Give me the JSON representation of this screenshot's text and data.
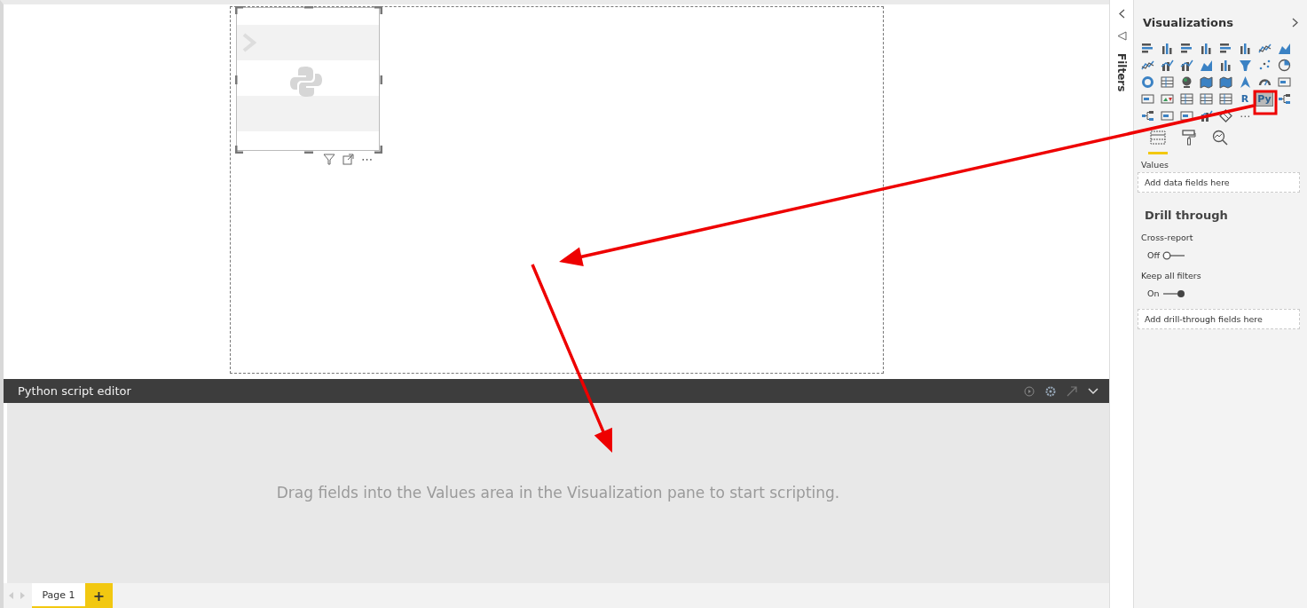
{
  "report_canvas": {
    "visual_header": {
      "more": "⋯"
    }
  },
  "script_editor": {
    "title": "Python script editor",
    "message": "Drag fields into the Values area in the Visualization pane to start scripting."
  },
  "page_tabs": [
    {
      "label": "Page 1",
      "selected": true
    }
  ],
  "add_page": "+",
  "filters_pane": {
    "label": "Filters",
    "expanded": false
  },
  "visualizations": {
    "title": "Visualizations",
    "script_visuals": [
      {
        "label": "R",
        "selected": false
      },
      {
        "label": "Py",
        "selected": true
      }
    ],
    "more": "⋯",
    "pane_tabs": [
      {
        "kind": "fields",
        "selected": true
      },
      {
        "kind": "format",
        "selected": false
      },
      {
        "kind": "analytics",
        "selected": false
      }
    ],
    "values": {
      "label": "Values",
      "placeholder": "Add data fields here"
    },
    "drill_through": {
      "title": "Drill through",
      "toggles": [
        {
          "label": "Cross-report",
          "state_label": "Off",
          "on": false
        },
        {
          "label": "Keep all filters",
          "state_label": "On",
          "on": true
        }
      ],
      "placeholder": "Add drill-through fields here"
    }
  }
}
